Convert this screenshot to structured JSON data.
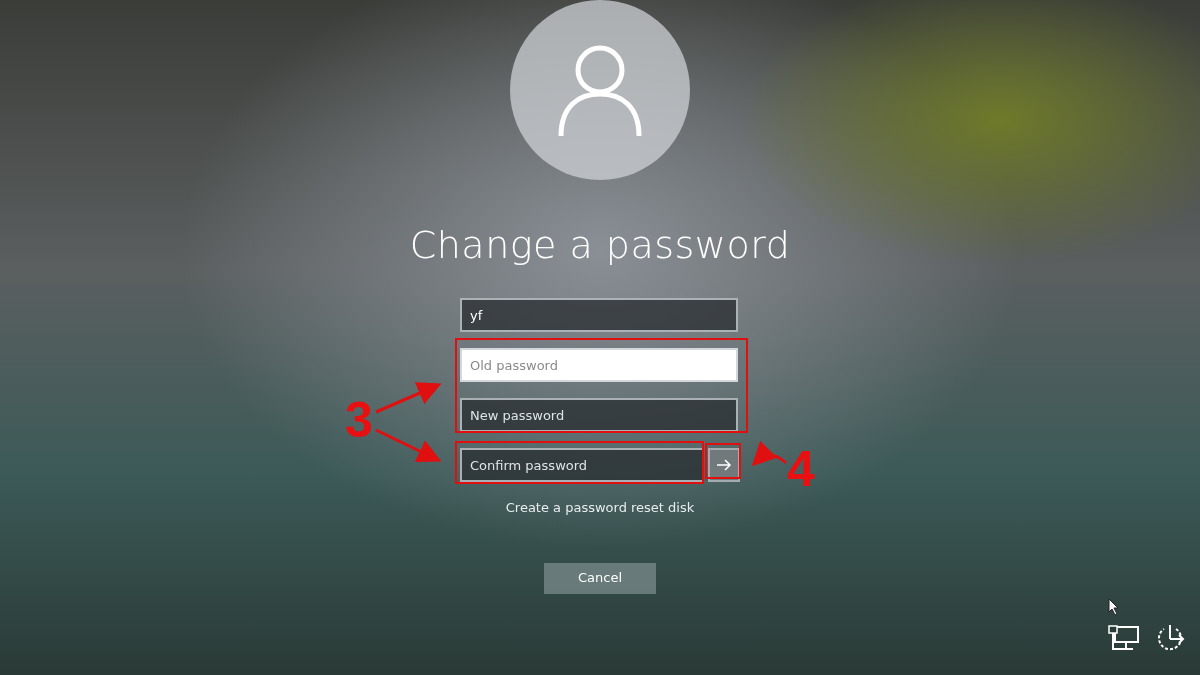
{
  "title": "Change a password",
  "fields": [
    {
      "value": "yf",
      "focused": false,
      "submit": false
    },
    {
      "placeholder": "Old password",
      "focused": true,
      "submit": false
    },
    {
      "placeholder": "New password",
      "focused": false,
      "submit": false
    },
    {
      "placeholder": "Confirm password",
      "focused": false,
      "submit": true
    }
  ],
  "reset_link": "Create a password reset disk",
  "cancel_button": "Cancel",
  "annotation_numbers": [
    "3",
    "4"
  ]
}
